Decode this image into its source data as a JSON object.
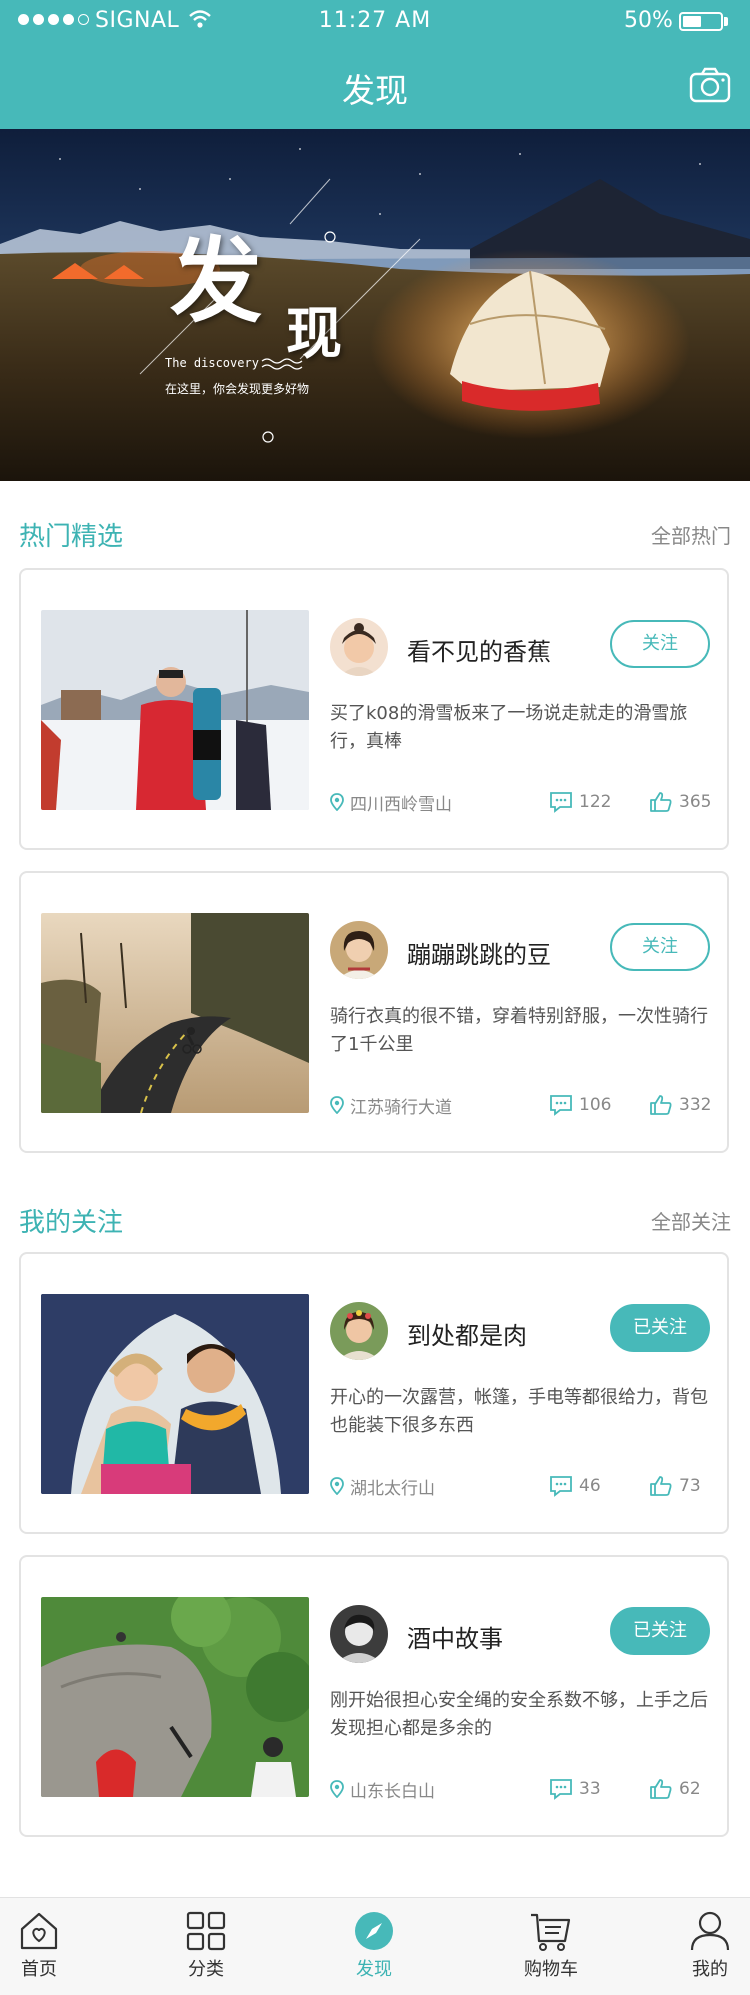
{
  "status_bar": {
    "carrier": "SIGNAL",
    "time": "11:27 AM",
    "battery": "50%",
    "battery_level": 0.5
  },
  "nav": {
    "title": "发现",
    "camera_icon": "camera-icon"
  },
  "hero": {
    "title_1": "发",
    "title_2": "现",
    "subtitle_en": "The discovery",
    "subtitle_cn": "在这里，你会发现更多好物"
  },
  "sections": [
    {
      "title": "热门精选",
      "more": "全部热门",
      "cards": [
        {
          "user": "看不见的香蕉",
          "follow_label": "关注",
          "followed": false,
          "desc": "买了k08的滑雪板来了一场说走就走的滑雪旅行，真棒",
          "location": "四川西岭雪山",
          "comments": "122",
          "likes": "365"
        },
        {
          "user": "蹦蹦跳跳的豆",
          "follow_label": "关注",
          "followed": false,
          "desc": "骑行衣真的很不错，穿着特别舒服，一次性骑行了1千公里",
          "location": "江苏骑行大道",
          "comments": "106",
          "likes": "332"
        }
      ]
    },
    {
      "title": "我的关注",
      "more": "全部关注",
      "cards": [
        {
          "user": "到处都是肉",
          "follow_label": "已关注",
          "followed": true,
          "desc": "开心的一次露营，帐篷，手电等都很给力，背包也能装下很多东西",
          "location": "湖北太行山",
          "comments": "46",
          "likes": "73"
        },
        {
          "user": "酒中故事",
          "follow_label": "已关注",
          "followed": true,
          "desc": "刚开始很担心安全绳的安全系数不够，上手之后发现担心都是多余的",
          "location": "山东长白山",
          "comments": "33",
          "likes": "62"
        }
      ]
    }
  ],
  "tabbar": {
    "items": [
      {
        "label": "首页",
        "icon": "home-icon"
      },
      {
        "label": "分类",
        "icon": "grid-icon"
      },
      {
        "label": "发现",
        "icon": "compass-icon",
        "active": true
      },
      {
        "label": "购物车",
        "icon": "cart-icon"
      },
      {
        "label": "我的",
        "icon": "user-icon"
      }
    ]
  },
  "colors": {
    "brand": "#47b9b9",
    "section_title": "#3db3b3"
  }
}
